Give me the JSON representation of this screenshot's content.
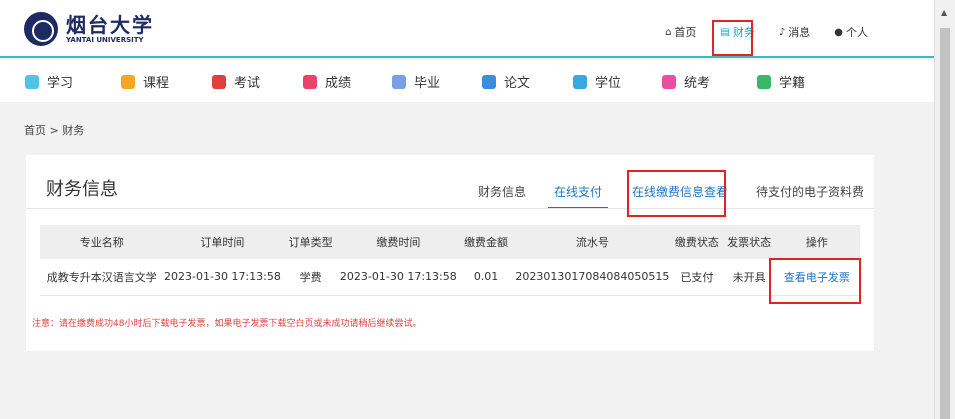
{
  "header": {
    "logo_cn": "烟台大学",
    "logo_en": "YANTAI UNIVERSITY",
    "links": [
      {
        "icon": "home-icon",
        "glyph": "⌂",
        "label": "首页"
      },
      {
        "icon": "database-icon",
        "glyph": "▤",
        "label": "财务"
      },
      {
        "icon": "bell-icon",
        "glyph": "♪",
        "label": "消息"
      },
      {
        "icon": "user-icon",
        "glyph": "●",
        "label": "个人"
      }
    ],
    "active_color": "#1ea2c7"
  },
  "nav": {
    "items": [
      {
        "label": "学习",
        "color": "#4fc3e8"
      },
      {
        "label": "课程",
        "color": "#f5a623"
      },
      {
        "label": "考试",
        "color": "#e0403d"
      },
      {
        "label": "成绩",
        "color": "#e8456a"
      },
      {
        "label": "毕业",
        "color": "#7a9ee8"
      },
      {
        "label": "论文",
        "color": "#3b8de0"
      },
      {
        "label": "学位",
        "color": "#3aa8e0"
      },
      {
        "label": "统考",
        "color": "#e84fa0"
      },
      {
        "label": "学籍",
        "color": "#3ab86a"
      }
    ]
  },
  "breadcrumb": "首页 > 财务",
  "panel": {
    "title": "财务信息",
    "tabs": [
      "财务信息",
      "在线支付",
      "在线缴费信息查看",
      "待支付的电子资料费"
    ]
  },
  "table": {
    "headers": [
      "专业名称",
      "订单时间",
      "订单类型",
      "缴费时间",
      "缴费金额",
      "流水号",
      "缴费状态",
      "发票状态",
      "操作"
    ],
    "rows": [
      [
        "成教专升本汉语言文学",
        "2023-01-30 17:13:58",
        "学费",
        "2023-01-30 17:13:58",
        "0.01",
        "20230130170840840505​15",
        "已支付",
        "未开具",
        "查看电子发票"
      ]
    ]
  },
  "notice": "注意：请在缴费成功48小时后下载电子发票，如果电子发票下载空白页或未成功请稍后继续尝试。",
  "colors": {
    "accent": "#1a75c6",
    "highlight_box": "#e02424",
    "notice": "#e04040"
  }
}
